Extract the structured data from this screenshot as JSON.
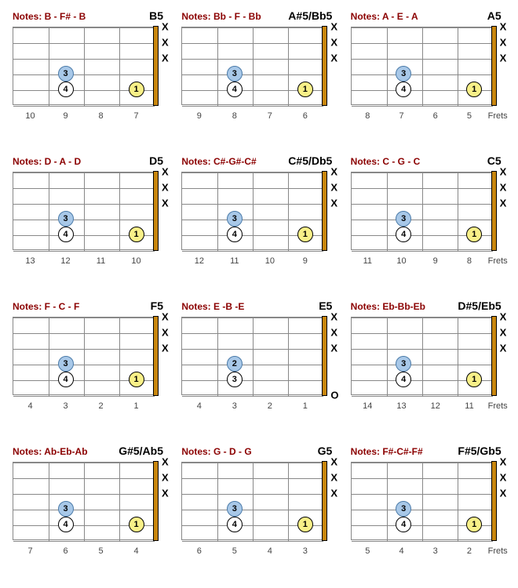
{
  "chart_data": {
    "type": "table",
    "title": "Power Chord Diagrams (5th chords) on guitar",
    "strings": 6,
    "frets_shown": 4,
    "chords": [
      {
        "name": "B5",
        "notes": "B - F# - B",
        "fret_labels": [
          "10",
          "9",
          "8",
          "7"
        ],
        "fingers": [
          {
            "string": 5,
            "fret_col": 2,
            "label": "4",
            "style": "white"
          },
          {
            "string": 4,
            "fret_col": 2,
            "label": "3",
            "style": "blue"
          },
          {
            "string": 5,
            "fret_col": 4,
            "label": "1",
            "style": "yellow"
          }
        ],
        "muted_strings": [
          1,
          2,
          3
        ],
        "open_strings": [],
        "show_frets_word": false
      },
      {
        "name": "A#5/Bb5",
        "notes": "Bb - F - Bb",
        "fret_labels": [
          "9",
          "8",
          "7",
          "6"
        ],
        "fingers": [
          {
            "string": 5,
            "fret_col": 2,
            "label": "4",
            "style": "white"
          },
          {
            "string": 4,
            "fret_col": 2,
            "label": "3",
            "style": "blue"
          },
          {
            "string": 5,
            "fret_col": 4,
            "label": "1",
            "style": "yellow"
          }
        ],
        "muted_strings": [
          1,
          2,
          3
        ],
        "open_strings": [],
        "show_frets_word": false
      },
      {
        "name": "A5",
        "notes": "A - E - A",
        "fret_labels": [
          "8",
          "7",
          "6",
          "5"
        ],
        "fingers": [
          {
            "string": 5,
            "fret_col": 2,
            "label": "4",
            "style": "white"
          },
          {
            "string": 4,
            "fret_col": 2,
            "label": "3",
            "style": "blue"
          },
          {
            "string": 5,
            "fret_col": 4,
            "label": "1",
            "style": "yellow"
          }
        ],
        "muted_strings": [
          1,
          2,
          3
        ],
        "open_strings": [],
        "show_frets_word": true
      },
      {
        "name": "D5",
        "notes": "D - A - D",
        "fret_labels": [
          "13",
          "12",
          "11",
          "10"
        ],
        "fingers": [
          {
            "string": 5,
            "fret_col": 2,
            "label": "4",
            "style": "white"
          },
          {
            "string": 4,
            "fret_col": 2,
            "label": "3",
            "style": "blue"
          },
          {
            "string": 5,
            "fret_col": 4,
            "label": "1",
            "style": "yellow"
          }
        ],
        "muted_strings": [
          1,
          2,
          3
        ],
        "open_strings": [],
        "show_frets_word": false
      },
      {
        "name": "C#5/Db5",
        "notes": "C#-G#-C#",
        "fret_labels": [
          "12",
          "11",
          "10",
          "9"
        ],
        "fingers": [
          {
            "string": 5,
            "fret_col": 2,
            "label": "4",
            "style": "white"
          },
          {
            "string": 4,
            "fret_col": 2,
            "label": "3",
            "style": "blue"
          },
          {
            "string": 5,
            "fret_col": 4,
            "label": "1",
            "style": "yellow"
          }
        ],
        "muted_strings": [
          1,
          2,
          3
        ],
        "open_strings": [],
        "show_frets_word": false
      },
      {
        "name": "C5",
        "notes": "C - G - C",
        "fret_labels": [
          "11",
          "10",
          "9",
          "8"
        ],
        "fingers": [
          {
            "string": 5,
            "fret_col": 2,
            "label": "4",
            "style": "white"
          },
          {
            "string": 4,
            "fret_col": 2,
            "label": "3",
            "style": "blue"
          },
          {
            "string": 5,
            "fret_col": 4,
            "label": "1",
            "style": "yellow"
          }
        ],
        "muted_strings": [
          1,
          2,
          3
        ],
        "open_strings": [],
        "show_frets_word": true
      },
      {
        "name": "F5",
        "notes": "F - C - F",
        "fret_labels": [
          "4",
          "3",
          "2",
          "1"
        ],
        "fingers": [
          {
            "string": 5,
            "fret_col": 2,
            "label": "4",
            "style": "white"
          },
          {
            "string": 4,
            "fret_col": 2,
            "label": "3",
            "style": "blue"
          },
          {
            "string": 5,
            "fret_col": 4,
            "label": "1",
            "style": "yellow"
          }
        ],
        "muted_strings": [
          1,
          2,
          3
        ],
        "open_strings": [],
        "show_frets_word": false
      },
      {
        "name": "E5",
        "notes": "E -B -E",
        "fret_labels": [
          "4",
          "3",
          "2",
          "1"
        ],
        "fingers": [
          {
            "string": 5,
            "fret_col": 2,
            "label": "3",
            "style": "white"
          },
          {
            "string": 4,
            "fret_col": 2,
            "label": "2",
            "style": "blue"
          }
        ],
        "muted_strings": [
          1,
          2,
          3
        ],
        "open_strings": [
          6
        ],
        "show_frets_word": false
      },
      {
        "name": "D#5/Eb5",
        "notes": "Eb-Bb-Eb",
        "fret_labels": [
          "14",
          "13",
          "12",
          "11"
        ],
        "fingers": [
          {
            "string": 5,
            "fret_col": 2,
            "label": "4",
            "style": "white"
          },
          {
            "string": 4,
            "fret_col": 2,
            "label": "3",
            "style": "blue"
          },
          {
            "string": 5,
            "fret_col": 4,
            "label": "1",
            "style": "yellow"
          }
        ],
        "muted_strings": [
          1,
          2,
          3
        ],
        "open_strings": [],
        "show_frets_word": true
      },
      {
        "name": "G#5/Ab5",
        "notes": "Ab-Eb-Ab",
        "fret_labels": [
          "7",
          "6",
          "5",
          "4"
        ],
        "fingers": [
          {
            "string": 5,
            "fret_col": 2,
            "label": "4",
            "style": "white"
          },
          {
            "string": 4,
            "fret_col": 2,
            "label": "3",
            "style": "blue"
          },
          {
            "string": 5,
            "fret_col": 4,
            "label": "1",
            "style": "yellow"
          }
        ],
        "muted_strings": [
          1,
          2,
          3
        ],
        "open_strings": [],
        "show_frets_word": false
      },
      {
        "name": "G5",
        "notes": "G - D - G",
        "fret_labels": [
          "6",
          "5",
          "4",
          "3"
        ],
        "fingers": [
          {
            "string": 5,
            "fret_col": 2,
            "label": "4",
            "style": "white"
          },
          {
            "string": 4,
            "fret_col": 2,
            "label": "3",
            "style": "blue"
          },
          {
            "string": 5,
            "fret_col": 4,
            "label": "1",
            "style": "yellow"
          }
        ],
        "muted_strings": [
          1,
          2,
          3
        ],
        "open_strings": [],
        "show_frets_word": false
      },
      {
        "name": "F#5/Gb5",
        "notes": "F#-C#-F#",
        "fret_labels": [
          "5",
          "4",
          "3",
          "2"
        ],
        "fingers": [
          {
            "string": 5,
            "fret_col": 2,
            "label": "4",
            "style": "white"
          },
          {
            "string": 4,
            "fret_col": 2,
            "label": "3",
            "style": "blue"
          },
          {
            "string": 5,
            "fret_col": 4,
            "label": "1",
            "style": "yellow"
          }
        ],
        "muted_strings": [
          1,
          2,
          3
        ],
        "open_strings": [],
        "show_frets_word": true
      }
    ]
  },
  "labels": {
    "notes_prefix": "Notes:",
    "frets_word": "Frets",
    "mute_symbol": "X",
    "open_symbol": "O"
  }
}
